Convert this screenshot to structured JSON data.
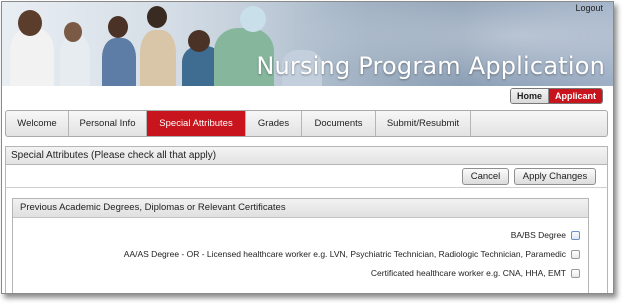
{
  "header": {
    "title": "Nursing Program Application",
    "logout": "Logout"
  },
  "roles": [
    {
      "label": "Home",
      "active": false
    },
    {
      "label": "Applicant",
      "active": true
    }
  ],
  "tabs": [
    {
      "label": "Welcome",
      "active": false
    },
    {
      "label": "Personal Info",
      "active": false
    },
    {
      "label": "Special Attributes",
      "active": true
    },
    {
      "label": "Grades",
      "active": false
    },
    {
      "label": "Documents",
      "active": false
    },
    {
      "label": "Submit/Resubmit",
      "active": false
    }
  ],
  "section": {
    "title": "Special Attributes (Please check all that apply)",
    "cancel_label": "Cancel",
    "apply_label": "Apply Changes"
  },
  "panel": {
    "title": "Previous Academic Degrees, Diplomas or Relevant Certificates",
    "options": [
      {
        "label": "BA/BS Degree",
        "checked": false
      },
      {
        "label": "AA/AS Degree - OR - Licensed healthcare worker e.g. LVN, Psychiatric Technician, Radiologic Technician, Paramedic",
        "checked": false
      },
      {
        "label": "Certificated healthcare worker e.g. CNA, HHA, EMT",
        "checked": false
      }
    ]
  },
  "colors": {
    "accent": "#c8141c",
    "banner_text": "#ffffff"
  }
}
